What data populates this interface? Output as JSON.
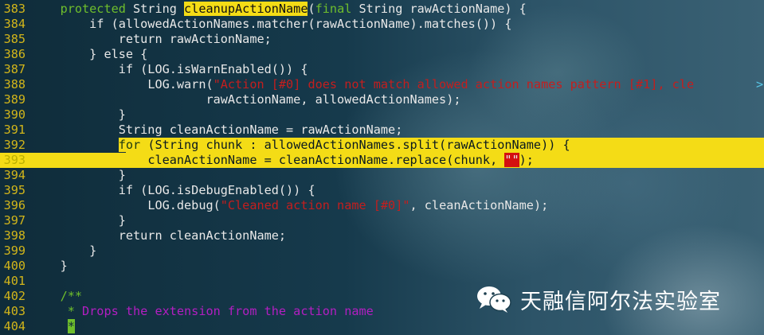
{
  "lines": [
    {
      "num": "383",
      "indent": "    ",
      "tokens": [
        {
          "t": "protected",
          "c": "kw"
        },
        {
          "t": " String "
        },
        {
          "t": "cleanupActionName",
          "c": "search"
        },
        {
          "t": "("
        },
        {
          "t": "final",
          "c": "kw"
        },
        {
          "t": " String rawActionName) {"
        }
      ]
    },
    {
      "num": "384",
      "indent": "        ",
      "tokens": [
        {
          "t": "if (allowedActionNames.matcher(rawActionName).matches()) {"
        }
      ]
    },
    {
      "num": "385",
      "indent": "            ",
      "tokens": [
        {
          "t": "return rawActionName;"
        }
      ]
    },
    {
      "num": "386",
      "indent": "        ",
      "tokens": [
        {
          "t": "} else {"
        }
      ]
    },
    {
      "num": "387",
      "indent": "            ",
      "tokens": [
        {
          "t": "if (LOG.isWarnEnabled()) {"
        }
      ]
    },
    {
      "num": "388",
      "indent": "                ",
      "tokens": [
        {
          "t": "LOG.warn("
        },
        {
          "t": "\"Action [#0] does not match allowed action names pattern [#1], cle",
          "c": "str"
        }
      ],
      "overflow": ">"
    },
    {
      "num": "389",
      "indent": "                        ",
      "tokens": [
        {
          "t": "rawActionName, allowedActionNames);"
        }
      ]
    },
    {
      "num": "390",
      "indent": "            ",
      "tokens": [
        {
          "t": "}"
        }
      ]
    },
    {
      "num": "391",
      "indent": "            ",
      "tokens": [
        {
          "t": "String cleanActionName = rawActionName;"
        }
      ]
    },
    {
      "num": "392",
      "indent": "            ",
      "highlight": "partial",
      "tokens": [
        {
          "t": "for",
          "c": "kw"
        },
        {
          "t": " (String chunk : allowedActionNames.split(rawActionName)) {"
        }
      ]
    },
    {
      "num": "393",
      "indent": "                ",
      "highlight": "full",
      "tokens": [
        {
          "t": "cleanActionName = cleanActionName.replace(chunk, "
        },
        {
          "t": "\"\"",
          "c": "redbox"
        },
        {
          "t": ");"
        }
      ]
    },
    {
      "num": "394",
      "indent": "            ",
      "tokens": [
        {
          "t": "}"
        }
      ]
    },
    {
      "num": "395",
      "indent": "            ",
      "tokens": [
        {
          "t": "if (LOG.isDebugEnabled()) {"
        }
      ]
    },
    {
      "num": "396",
      "indent": "                ",
      "tokens": [
        {
          "t": "LOG.debug("
        },
        {
          "t": "\"Cleaned action name [#0]\"",
          "c": "str"
        },
        {
          "t": ", cleanActionName);"
        }
      ]
    },
    {
      "num": "397",
      "indent": "            ",
      "tokens": [
        {
          "t": "}"
        }
      ]
    },
    {
      "num": "398",
      "indent": "            ",
      "tokens": [
        {
          "t": "return cleanActionName;"
        }
      ]
    },
    {
      "num": "399",
      "indent": "        ",
      "tokens": [
        {
          "t": "}"
        }
      ]
    },
    {
      "num": "400",
      "indent": "    ",
      "tokens": [
        {
          "t": "}"
        }
      ]
    },
    {
      "num": "401",
      "indent": "",
      "tokens": []
    },
    {
      "num": "402",
      "indent": "    ",
      "tokens": [
        {
          "t": "/**",
          "c": "cm-prefix"
        }
      ]
    },
    {
      "num": "403",
      "indent": "     ",
      "tokens": [
        {
          "t": "*",
          "c": "cm-prefix"
        },
        {
          "t": " Drops the extension from the action name",
          "c": "cm"
        }
      ]
    },
    {
      "num": "404",
      "indent": "     ",
      "tokens": [
        {
          "t": "*",
          "c": "cursor-box"
        }
      ]
    }
  ],
  "watermark": {
    "text": "天融信阿尔法实验室",
    "icon": "wechat-icon"
  },
  "colors": {
    "line_highlight": "#f4dc16",
    "keyword": "#6fbe2c",
    "string": "#c41e1e",
    "comment": "#b31ec2",
    "line_number": "#d2b51a"
  }
}
